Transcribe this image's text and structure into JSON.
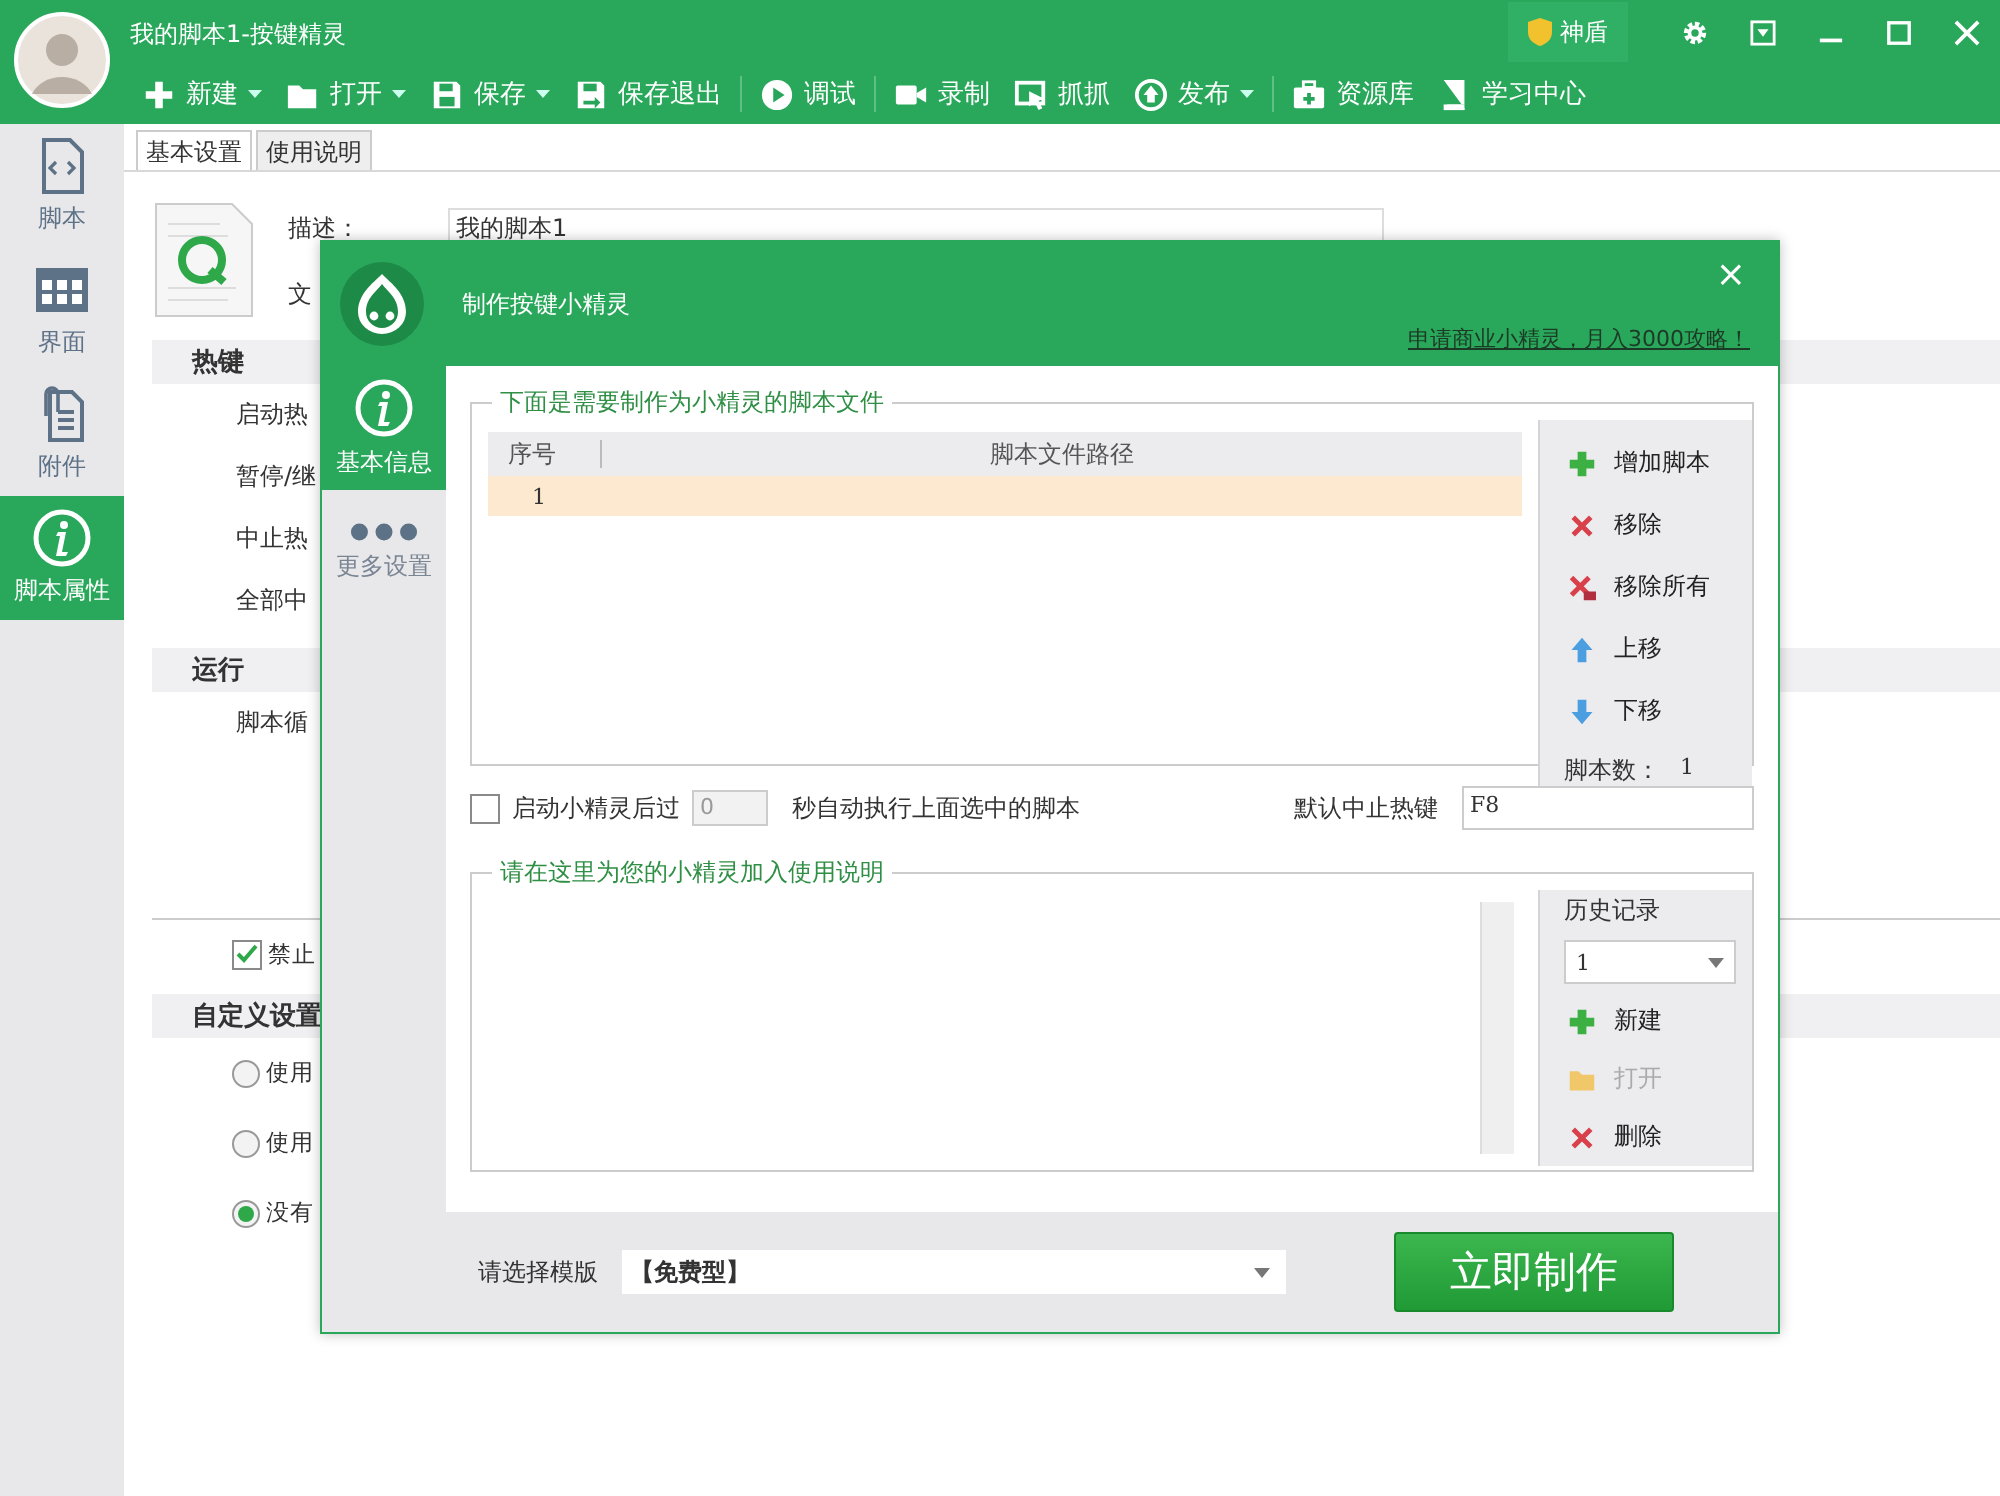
{
  "window": {
    "title": "我的脚本1-按键精灵",
    "shield_label": "神盾"
  },
  "toolbar": [
    {
      "label": "新建",
      "kind": "new",
      "dropdown": true
    },
    {
      "label": "打开",
      "kind": "open",
      "dropdown": true
    },
    {
      "label": "保存",
      "kind": "save",
      "dropdown": true
    },
    {
      "label": "保存退出",
      "kind": "save_exit",
      "dropdown": false
    },
    {
      "label": "调试",
      "kind": "debug",
      "dropdown": false
    },
    {
      "label": "录制",
      "kind": "record",
      "dropdown": false
    },
    {
      "label": "抓抓",
      "kind": "grab",
      "dropdown": false
    },
    {
      "label": "发布",
      "kind": "publish",
      "dropdown": true
    },
    {
      "label": "资源库",
      "kind": "resources",
      "dropdown": false
    },
    {
      "label": "学习中心",
      "kind": "learn",
      "dropdown": false
    }
  ],
  "sidebar": {
    "items": [
      {
        "label": "脚本",
        "kind": "script",
        "selected": false
      },
      {
        "label": "界面",
        "kind": "interface",
        "selected": false
      },
      {
        "label": "附件",
        "kind": "attachment",
        "selected": false
      },
      {
        "label": "脚本属性",
        "kind": "info",
        "selected": true
      }
    ]
  },
  "tabs": [
    {
      "label": "基本设置",
      "selected": true
    },
    {
      "label": "使用说明",
      "selected": false
    }
  ],
  "background": {
    "description_label": "描述：",
    "description_value": "我的脚本1",
    "file_label": "文",
    "sections": [
      {
        "title": "热键",
        "rows": [
          "启动热",
          "暂停/继",
          "中止热",
          "全部中"
        ]
      },
      {
        "title": "运行",
        "rows": [
          "脚本循"
        ]
      }
    ],
    "forbid": {
      "label": "禁止",
      "checked": true
    },
    "custom": {
      "title": "自定义设置",
      "options": [
        {
          "label": "使用",
          "selected": false
        },
        {
          "label": "使用",
          "selected": false
        },
        {
          "label": "没有",
          "selected": true
        }
      ]
    }
  },
  "dialog": {
    "title": "制作按键小精灵",
    "promo_link": "申请商业小精灵，月入3000攻略！",
    "close": "×",
    "nav": [
      {
        "label": "基本信息",
        "kind": "info",
        "selected": true
      },
      {
        "label": "更多设置",
        "kind": "more",
        "selected": false
      }
    ],
    "scripts_group": {
      "legend": "下面是需要制作为小精灵的脚本文件",
      "columns": [
        "序号",
        "脚本文件路径"
      ],
      "rows": [
        {
          "index": "1",
          "selected": true
        }
      ],
      "actions": [
        {
          "label": "增加脚本",
          "kind": "add"
        },
        {
          "label": "移除",
          "kind": "remove"
        },
        {
          "label": "移除所有",
          "kind": "remove_all"
        },
        {
          "label": "上移",
          "kind": "up"
        },
        {
          "label": "下移",
          "kind": "down"
        }
      ],
      "count_label": "脚本数：",
      "count": "1"
    },
    "autorun": {
      "checked": false,
      "label": "启动小精灵后过",
      "seconds": "0",
      "seconds_disabled": true,
      "suffix": "秒自动执行上面选中的脚本"
    },
    "stop_hotkey": {
      "label": "默认中止热键",
      "value": "F8"
    },
    "notes_group": {
      "legend": "请在这里为您的小精灵加入使用说明",
      "history_label": "历史记录",
      "history_value": "1",
      "actions": [
        {
          "label": "新建",
          "kind": "add",
          "disabled": false
        },
        {
          "label": "打开",
          "kind": "open",
          "disabled": true
        },
        {
          "label": "删除",
          "kind": "remove",
          "disabled": false
        }
      ]
    },
    "template": {
      "label": "请选择模版",
      "value": "【免费型】"
    },
    "submit": "立即制作"
  }
}
